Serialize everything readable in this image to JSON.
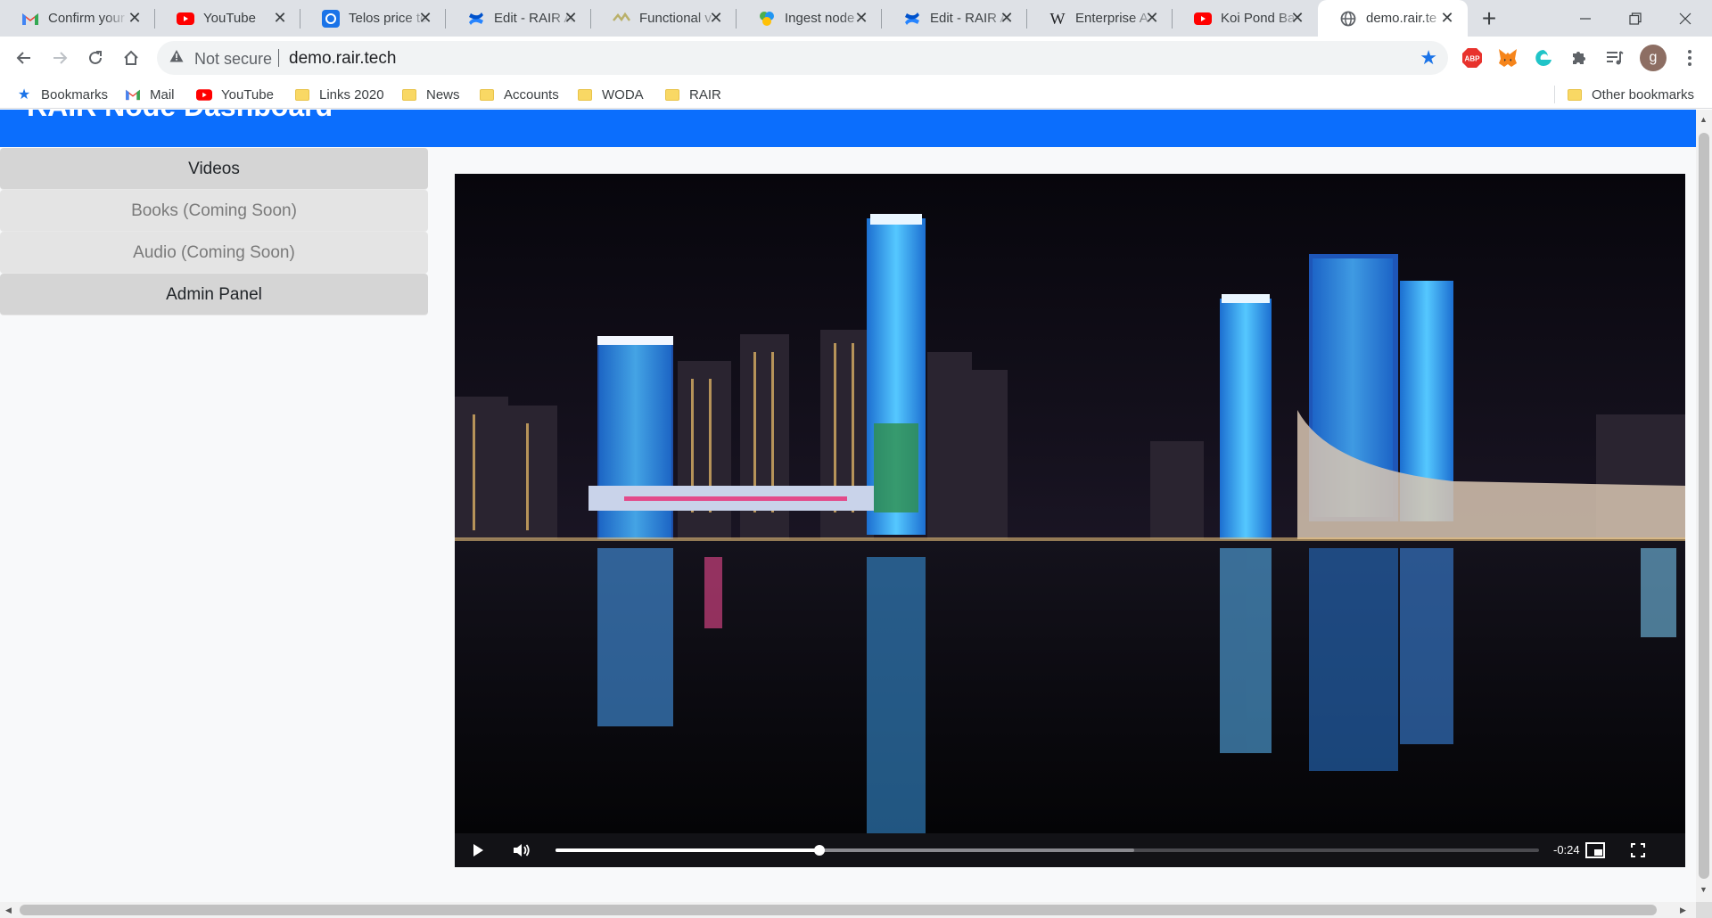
{
  "browser": {
    "tabs": [
      {
        "title": "Confirm your",
        "icon": "gmail-icon",
        "color": "#ea4335"
      },
      {
        "title": "YouTube",
        "icon": "youtube-icon",
        "color": "#ff0000"
      },
      {
        "title": "Telos price to",
        "icon": "telos-icon",
        "color": "#1a73e8"
      },
      {
        "title": "Edit - RAIR A",
        "icon": "confluence-icon",
        "color": "#2684ff"
      },
      {
        "title": "Functional v",
        "icon": "functional-icon",
        "color": "#b9b06a"
      },
      {
        "title": "Ingest node",
        "icon": "ingest-icon",
        "color": "#4caf50"
      },
      {
        "title": "Edit - RAIR A",
        "icon": "confluence-icon",
        "color": "#2684ff"
      },
      {
        "title": "Enterprise A",
        "icon": "wikipedia-icon",
        "color": "#202124"
      },
      {
        "title": "Koi Pond Ba",
        "icon": "youtube-icon",
        "color": "#ff0000"
      },
      {
        "title": "demo.rair.te",
        "icon": "globe-icon",
        "color": "#5f6368"
      }
    ],
    "new_tab": "+",
    "security_label": "Not secure",
    "url": "demo.rair.tech",
    "profile_initial": "g",
    "extensions": [
      "adblock-icon",
      "metamask-icon",
      "edge-icon",
      "puzzle-icon",
      "playlist-icon"
    ],
    "adblock_label": "ABP",
    "bookmarks": [
      {
        "label": "Bookmarks",
        "icon": "star-icon"
      },
      {
        "label": "Mail",
        "icon": "gmail-icon"
      },
      {
        "label": "YouTube",
        "icon": "youtube-icon"
      },
      {
        "label": "Links 2020",
        "icon": "folder-icon"
      },
      {
        "label": "News",
        "icon": "folder-icon"
      },
      {
        "label": "Accounts",
        "icon": "folder-icon"
      },
      {
        "label": "WODA",
        "icon": "folder-icon"
      },
      {
        "label": "RAIR",
        "icon": "folder-icon"
      }
    ],
    "other_bookmarks": "Other bookmarks"
  },
  "page": {
    "header_title": "RAIR Node Dashboard",
    "accent_color": "#0b6efd",
    "sidebar": [
      {
        "label": "Videos",
        "state": "active"
      },
      {
        "label": "Books (Coming Soon)",
        "state": "disabled"
      },
      {
        "label": "Audio (Coming Soon)",
        "state": "disabled"
      },
      {
        "label": "Admin Panel",
        "state": "active"
      }
    ],
    "video": {
      "time_remaining": "-0:24",
      "progress": 0.268,
      "buffered": 0.588
    }
  }
}
